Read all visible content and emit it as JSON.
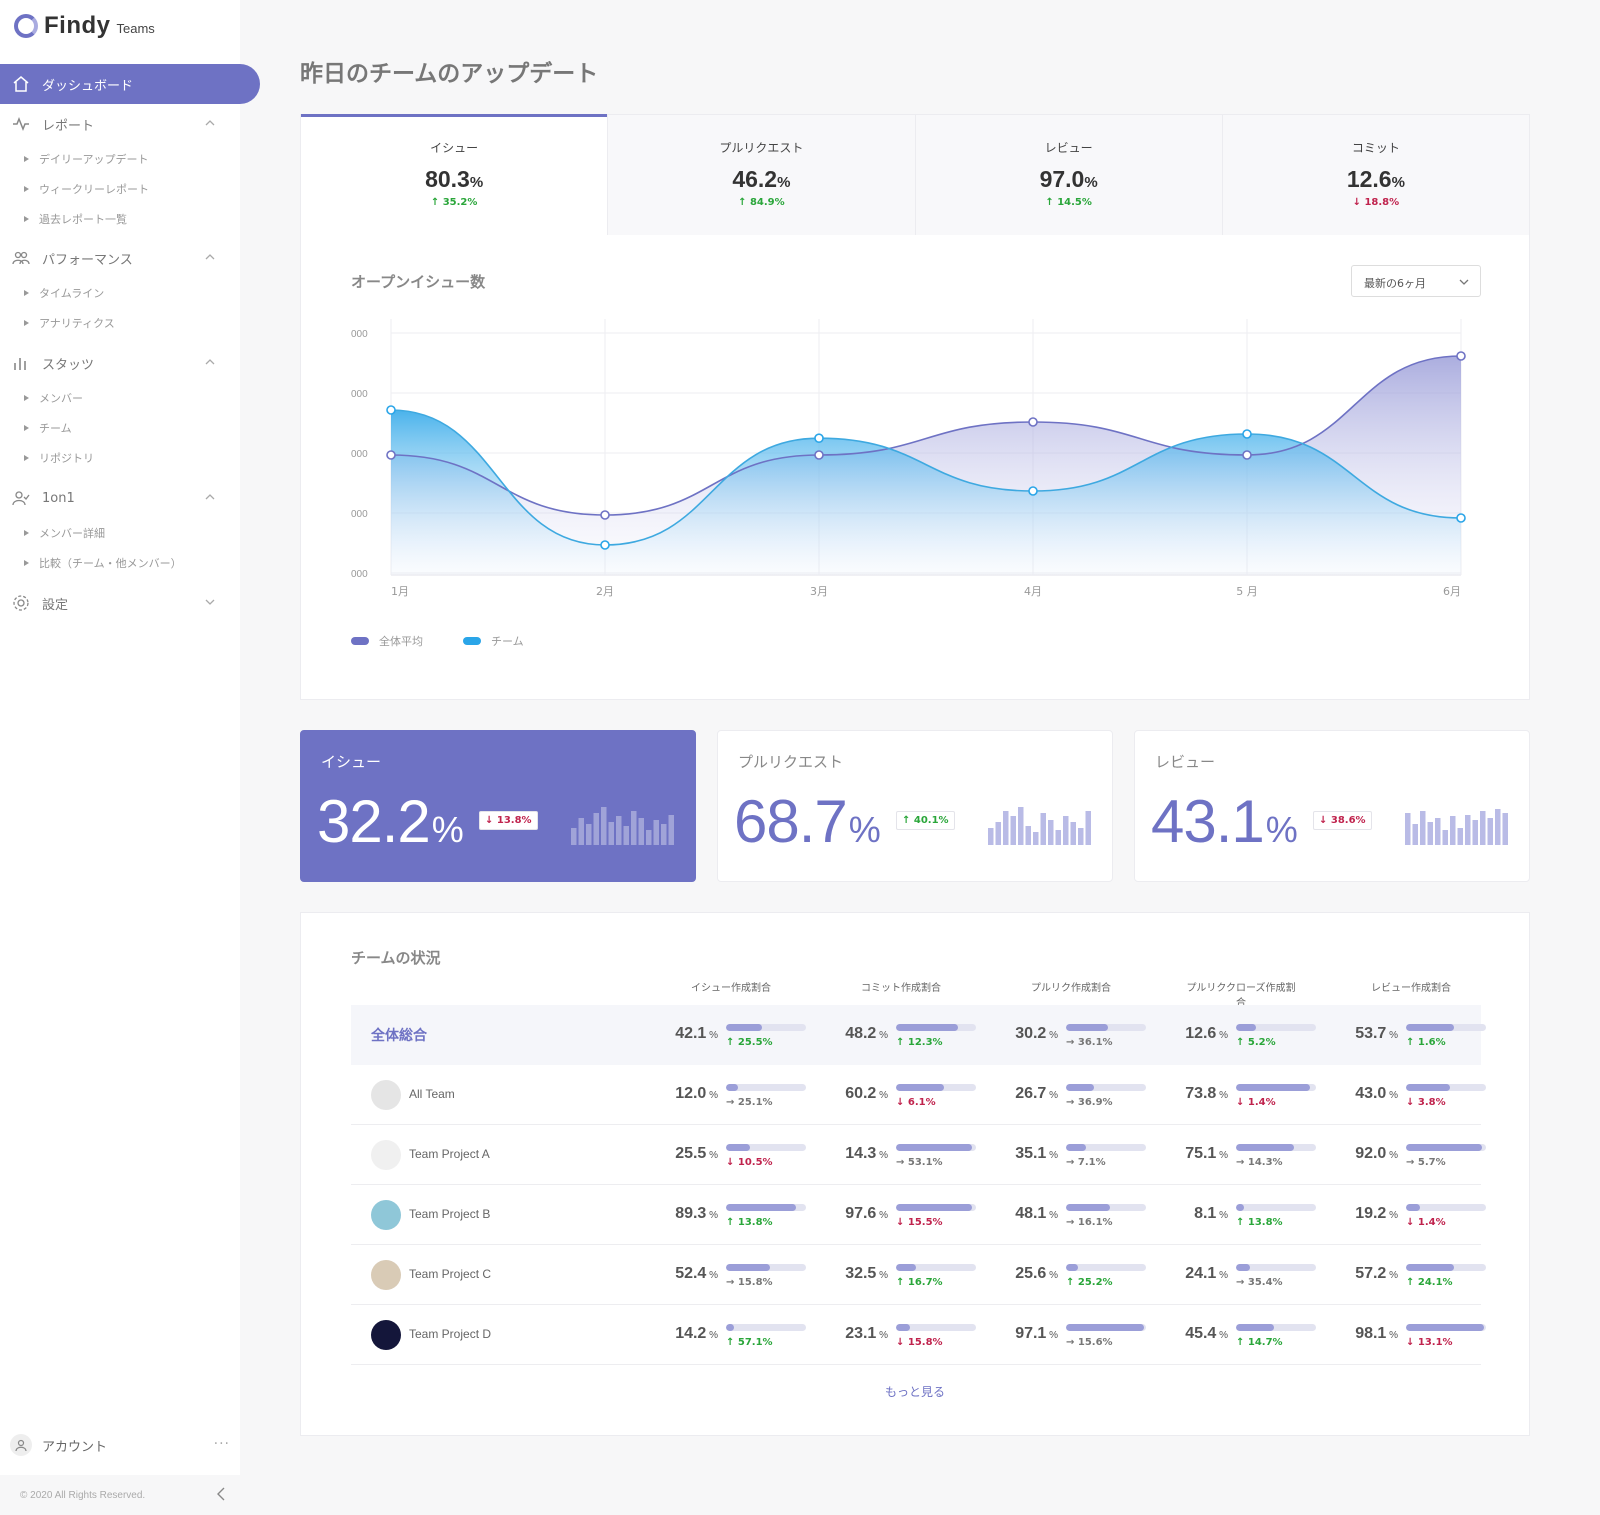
{
  "app": {
    "brand": "Findy",
    "brand_sub": "Teams"
  },
  "sidebar": {
    "active": "ダッシュボード",
    "groups": [
      {
        "label": "レポート",
        "items": [
          "デイリーアップデート",
          "ウィークリーレポート",
          "過去レポート一覧"
        ]
      },
      {
        "label": "パフォーマンス",
        "items": [
          "タイムライン",
          "アナリティクス"
        ]
      },
      {
        "label": "スタッツ",
        "items": [
          "メンバー",
          "チーム",
          "リポジトリ"
        ]
      },
      {
        "label": "1on1",
        "items": [
          "メンバー詳細",
          "比較（チーム・他メンバー）"
        ]
      },
      {
        "label": "設定",
        "items": []
      }
    ],
    "account": "アカウント",
    "more": "···",
    "copyright": "© 2020 All Rights Reserved."
  },
  "page": {
    "title": "昨日のチームのアップデート"
  },
  "tabs": [
    {
      "label": "イシュー",
      "value": "80.3",
      "unit": "%",
      "delta": "↑ 35.2%",
      "dir": "up"
    },
    {
      "label": "プルリクエスト",
      "value": "46.2",
      "unit": "%",
      "delta": "↑ 84.9%",
      "dir": "up"
    },
    {
      "label": "レビュー",
      "value": "97.0",
      "unit": "%",
      "delta": "↑ 14.5%",
      "dir": "up"
    },
    {
      "label": "コミット",
      "value": "12.6",
      "unit": "%",
      "delta": "↓ 18.8%",
      "dir": "down"
    }
  ],
  "chart": {
    "title": "オープンイシュー数",
    "period": "最新の6ヶ月"
  },
  "chart_data": {
    "type": "area",
    "categories": [
      "1月",
      "2月",
      "3月",
      "4月",
      "5 月",
      "6月"
    ],
    "ytick_labels": [
      "000",
      "000",
      "000",
      "000",
      "000"
    ],
    "ylim": [
      0,
      4
    ],
    "grid": true,
    "legend": "bottom-left",
    "series": [
      {
        "name": "全体平均",
        "color": "#6e72c4",
        "values": [
          2.0,
          1.0,
          2.0,
          2.55,
          2.0,
          3.65
        ]
      },
      {
        "name": "チーム",
        "color": "#2aa5e8",
        "values": [
          2.75,
          0.5,
          2.28,
          1.4,
          2.35,
          0.95
        ]
      }
    ]
  },
  "kpis": [
    {
      "label": "イシュー",
      "value": "32.2",
      "unit": "%",
      "delta": "↓ 13.8%",
      "dir": "down",
      "active": true,
      "bars": [
        0.45,
        0.7,
        0.55,
        0.85,
        1.0,
        0.6,
        0.75,
        0.5,
        0.9,
        0.7,
        0.4,
        0.65,
        0.55,
        0.8
      ]
    },
    {
      "label": "プルリクエスト",
      "value": "68.7",
      "unit": "%",
      "delta": "↑ 40.1%",
      "dir": "up",
      "active": false,
      "bars": [
        0.45,
        0.6,
        0.9,
        0.75,
        1.0,
        0.5,
        0.35,
        0.85,
        0.65,
        0.4,
        0.75,
        0.6,
        0.45,
        0.9
      ]
    },
    {
      "label": "レビュー",
      "value": "43.1",
      "unit": "%",
      "delta": "↓ 38.6%",
      "dir": "down",
      "active": false,
      "bars": [
        0.85,
        0.55,
        0.9,
        0.6,
        0.7,
        0.4,
        0.75,
        0.45,
        0.8,
        0.65,
        0.9,
        0.7,
        0.95,
        0.85
      ]
    }
  ],
  "team": {
    "title": "チームの状況",
    "columns": [
      "イシュー作成割合",
      "コミット作成割合",
      "プルリク作成割合",
      "プルリククローズ作成割合",
      "レビュー作成割合"
    ],
    "rows": [
      {
        "name": "全体総合",
        "total": true,
        "cells": [
          {
            "v": "42.1",
            "d": "↑ 25.5%",
            "dir": "up",
            "f": 0.45
          },
          {
            "v": "48.2",
            "d": "↑ 12.3%",
            "dir": "up",
            "f": 0.78
          },
          {
            "v": "30.2",
            "d": "→ 36.1%",
            "dir": "flat",
            "f": 0.52
          },
          {
            "v": "12.6",
            "d": "↑ 5.2%",
            "dir": "up",
            "f": 0.25
          },
          {
            "v": "53.7",
            "d": "↑ 1.6%",
            "dir": "up",
            "f": 0.6
          }
        ]
      },
      {
        "name": "All Team",
        "avatar": "#e5e5e5",
        "cells": [
          {
            "v": "12.0",
            "d": "→ 25.1%",
            "dir": "flat",
            "f": 0.15
          },
          {
            "v": "60.2",
            "d": "↓ 6.1%",
            "dir": "down",
            "f": 0.6
          },
          {
            "v": "26.7",
            "d": "→ 36.9%",
            "dir": "flat",
            "f": 0.35
          },
          {
            "v": "73.8",
            "d": "↓ 1.4%",
            "dir": "down",
            "f": 0.92
          },
          {
            "v": "43.0",
            "d": "↓ 3.8%",
            "dir": "down",
            "f": 0.55
          }
        ]
      },
      {
        "name": "Team Project A",
        "avatar": "#f0f0f0",
        "cells": [
          {
            "v": "25.5",
            "d": "↓ 10.5%",
            "dir": "down",
            "f": 0.3
          },
          {
            "v": "14.3",
            "d": "→ 53.1%",
            "dir": "flat",
            "f": 0.95
          },
          {
            "v": "35.1",
            "d": "→ 7.1%",
            "dir": "flat",
            "f": 0.25
          },
          {
            "v": "75.1",
            "d": "→ 14.3%",
            "dir": "flat",
            "f": 0.72
          },
          {
            "v": "92.0",
            "d": "→ 5.7%",
            "dir": "flat",
            "f": 0.95
          }
        ]
      },
      {
        "name": "Team Project B",
        "avatar": "#8fc7d8",
        "cells": [
          {
            "v": "89.3",
            "d": "↑ 13.8%",
            "dir": "up",
            "f": 0.88
          },
          {
            "v": "97.6",
            "d": "↓ 15.5%",
            "dir": "down",
            "f": 0.95
          },
          {
            "v": "48.1",
            "d": "→ 16.1%",
            "dir": "flat",
            "f": 0.55
          },
          {
            "v": "8.1",
            "d": "↑ 13.8%",
            "dir": "up",
            "f": 0.1
          },
          {
            "v": "19.2",
            "d": "↓ 1.4%",
            "dir": "down",
            "f": 0.18
          }
        ]
      },
      {
        "name": "Team Project C",
        "avatar": "#d9cbb6",
        "cells": [
          {
            "v": "52.4",
            "d": "→ 15.8%",
            "dir": "flat",
            "f": 0.55
          },
          {
            "v": "32.5",
            "d": "↑ 16.7%",
            "dir": "up",
            "f": 0.25
          },
          {
            "v": "25.6",
            "d": "↑ 25.2%",
            "dir": "up",
            "f": 0.15
          },
          {
            "v": "24.1",
            "d": "→ 35.4%",
            "dir": "flat",
            "f": 0.18
          },
          {
            "v": "57.2",
            "d": "↑ 24.1%",
            "dir": "up",
            "f": 0.6
          }
        ]
      },
      {
        "name": "Team Project D",
        "avatar": "#14163a",
        "cells": [
          {
            "v": "14.2",
            "d": "↑ 57.1%",
            "dir": "up",
            "f": 0.1
          },
          {
            "v": "23.1",
            "d": "↓ 15.8%",
            "dir": "down",
            "f": 0.18
          },
          {
            "v": "97.1",
            "d": "→ 15.6%",
            "dir": "flat",
            "f": 0.98
          },
          {
            "v": "45.4",
            "d": "↑ 14.7%",
            "dir": "up",
            "f": 0.48
          },
          {
            "v": "98.1",
            "d": "↓ 13.1%",
            "dir": "down",
            "f": 0.98
          }
        ]
      }
    ],
    "more": "もっと見る"
  },
  "colors": {
    "accent": "#6e72c4",
    "team_line": "#2aa5e8",
    "up": "#2aa63a",
    "down": "#c0234d"
  }
}
